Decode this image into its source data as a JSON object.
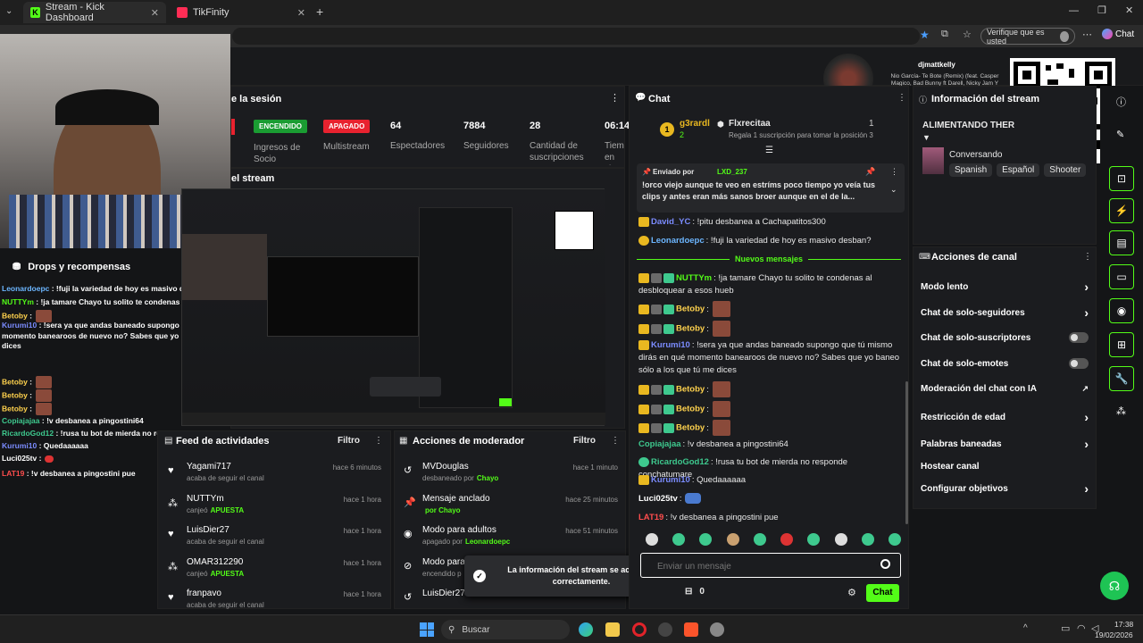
{
  "browser": {
    "tabs": [
      {
        "label": "Stream - Kick Dashboard",
        "active": true
      },
      {
        "label": "TikFinity",
        "active": false
      }
    ],
    "verify_label": "Verifique que es usted",
    "copilot_label": "Chat"
  },
  "dashboard": {
    "session_title": "e la sesión",
    "stats": [
      {
        "value": "64",
        "label": "Espectadores"
      },
      {
        "value": "7884",
        "label": "Seguidores"
      },
      {
        "value": "28",
        "label": "Cantidad de suscripciones"
      },
      {
        "value": "06:14",
        "label": "Tiemp en viv"
      }
    ],
    "status_on": "ENCENDIDO",
    "status_on_label": "Ingresos de Socio",
    "status_off": "APAGADO",
    "status_off_label": "Multistream",
    "stream_title": "el stream"
  },
  "now_playing": {
    "user": "djmattkelly",
    "track": "Nio García- Te Bote (Remix) (feat. Casper Magico, Bad Bunny ft Darell, Nicky Jam Y Ozuna)"
  },
  "overlay": {
    "drops_title": "Drops y recompensas",
    "lines": [
      {
        "user": "Leonardoepc",
        "text": " : !fuji la variedad de hoy es masivo desban?",
        "color": "#6cb6ff"
      },
      {
        "user": "NUTTYm",
        "text": " : !ja tamare Chayo tu solito te condenas al desbloquear a esos hueb",
        "color": "#53fc18"
      },
      {
        "user": "Betoby",
        "text": " :",
        "color": "#ffd24d"
      },
      {
        "user": "Kurumi10",
        "text": " : !sera ya que andas baneado supongo que tu mismo dirás en qué",
        "color": "#7b8cff"
      },
      {
        "user": "",
        "text": "momento banearoos de nuevo no? Sabes que yo baneo sólo a los que tú me",
        "color": "#fff"
      },
      {
        "user": "",
        "text": "dices",
        "color": "#fff"
      },
      {
        "user": "Betoby",
        "text": " :",
        "color": "#ffd24d"
      },
      {
        "user": "Betoby",
        "text": " :",
        "color": "#ffd24d"
      },
      {
        "user": "Betoby",
        "text": " :",
        "color": "#ffd24d"
      },
      {
        "user": "Copiajajaa",
        "text": " : !v desbanea a pingostini64",
        "color": "#3ec98e"
      },
      {
        "user": "RicardoGod12",
        "text": " : !rusa tu bot de mierda no responde conchatumare",
        "color": "#3ec98e"
      },
      {
        "user": "Kurumi10",
        "text": " : Quedaaaaaa",
        "color": "#7b8cff"
      },
      {
        "user": "Luci025tv",
        "text": " :",
        "color": "#fff"
      },
      {
        "user": "LAT19",
        "text": " : !v desbanea a pingostini pue",
        "color": "#ff4d4d"
      }
    ]
  },
  "activity_feed": {
    "title": "Feed de actividades",
    "filter": "Filtro",
    "items": [
      {
        "user": "Yagami717",
        "action": "acaba de seguir el canal",
        "time": "hace 6 minutos",
        "icon": "heart-icon"
      },
      {
        "user": "NUTTYm",
        "action": "canjeó",
        "highlight": "APUESTA",
        "time": "hace 1 hora",
        "icon": "reward-icon"
      },
      {
        "user": "LuisDier27",
        "action": "acaba de seguir el canal",
        "time": "hace 1 hora",
        "icon": "heart-icon"
      },
      {
        "user": "OMAR312290",
        "action": "canjeó",
        "highlight": "APUESTA",
        "time": "hace 1 hora",
        "icon": "reward-icon"
      },
      {
        "user": "franpavo",
        "action": "acaba de seguir el canal",
        "time": "hace 1 hora",
        "icon": "heart-icon"
      }
    ]
  },
  "mod_actions": {
    "title": "Acciones de moderador",
    "filter": "Filtro",
    "items": [
      {
        "title": "MVDouglas",
        "sub": "desbaneado por",
        "by": "Chayo",
        "time": "hace 1 minuto",
        "icon": "undo-icon"
      },
      {
        "title": "Mensaje anclado",
        "sub": "",
        "by": "por Chayo",
        "time": "hace 25 minutos",
        "icon": "pin-icon"
      },
      {
        "title": "Modo para adultos",
        "sub": "apagado por",
        "by": "Leonardoepc",
        "time": "hace 51 minutos",
        "icon": "eye-icon"
      },
      {
        "title": "Modo para",
        "sub": "encendido p",
        "by": "",
        "time": "",
        "icon": "eye-off-icon"
      },
      {
        "title": "LuisDier27",
        "sub": "",
        "by": "",
        "time": "",
        "icon": "undo-icon"
      }
    ]
  },
  "toast": {
    "text": "La información del stream se actualizó correctamente."
  },
  "chat": {
    "title": "Chat",
    "leader": {
      "name": "g3rardl",
      "count": "2"
    },
    "sub_gift": {
      "name": "Flxrecitaa",
      "rank": "1",
      "text": "Regala 1 suscripción para tomar la posición 3"
    },
    "pinned": {
      "label": "Enviado por",
      "user": "LXD_237",
      "text": "!orco viejo aunque te veo en estríms poco tiempo yo veía tus clips y antes eran más sanos broer aunque en el de la..."
    },
    "new_messages": "Nuevos mensajes",
    "messages": [
      {
        "user": "David_YC",
        "text": ": !pitu desbanea a Cachapatitos300",
        "color": "#7b8cff"
      },
      {
        "user": "Leonardoepc",
        "text": ": !fuji la variedad de hoy es masivo desban?",
        "color": "#6cb6ff"
      },
      {
        "user": "NUTTYm",
        "text": ": !ja tamare Chayo tu solito te condenas al desbloquear a esos hueb",
        "color": "#53fc18"
      },
      {
        "user": "Betoby",
        "text": ":",
        "color": "#ffd24d"
      },
      {
        "user": "Betoby",
        "text": ":",
        "color": "#ffd24d"
      },
      {
        "user": "Kurumi10",
        "text": ": !sera ya que andas baneado supongo que tú mismo dirás en qué momento banearoos de nuevo no? Sabes que yo baneo sólo a los que tú me dices",
        "color": "#7b8cff"
      },
      {
        "user": "Betoby",
        "text": ":",
        "color": "#ffd24d"
      },
      {
        "user": "Betoby",
        "text": ":",
        "color": "#ffd24d"
      },
      {
        "user": "Betoby",
        "text": ":",
        "color": "#ffd24d"
      },
      {
        "user": "Copiajajaa",
        "text": ": !v desbanea a pingostini64",
        "color": "#3ec98e"
      },
      {
        "user": "RicardoGod12",
        "text": ": !rusa tu bot de mierda no responde conchatumare",
        "color": "#3ec98e"
      },
      {
        "user": "Kurumi10",
        "text": ": Quedaaaaaa",
        "color": "#7b8cff"
      },
      {
        "user": "Luci025tv",
        "text": ":",
        "color": "#fff"
      },
      {
        "user": "LAT19",
        "text": ": !v desbanea a pingostini pue",
        "color": "#ff4d4d"
      }
    ],
    "input_placeholder": "Enviar un mensaje",
    "points": "0",
    "send": "Chat"
  },
  "stream_info": {
    "title": "Información del stream",
    "stream_title": "ALIMENTANDO THER",
    "category": "Conversando",
    "tags": [
      "Spanish",
      "Español",
      "Shooter"
    ]
  },
  "channel_actions": {
    "title": "Acciones de canal",
    "items": [
      {
        "label": "Modo lento",
        "type": "arrow"
      },
      {
        "label": "Chat de solo-seguidores",
        "type": "arrow"
      },
      {
        "label": "Chat de solo-suscriptores",
        "type": "toggle"
      },
      {
        "label": "Chat de solo-emotes",
        "type": "toggle"
      },
      {
        "label": "Moderación del chat con IA",
        "type": "external"
      },
      {
        "label": "Restricción de edad",
        "type": "arrow"
      },
      {
        "label": "Palabras baneadas",
        "type": "arrow"
      },
      {
        "label": "Hostear canal",
        "type": "none"
      },
      {
        "label": "Configurar objetivos",
        "type": "arrow"
      }
    ]
  },
  "qr": {
    "brand": "yape"
  },
  "taskbar": {
    "search": "Buscar",
    "time": "17:38",
    "date": "19/02/2026"
  },
  "colors": {
    "kick_green": "#53fc18",
    "danger": "#ff2d3b",
    "panel": "#1b1c1f"
  }
}
